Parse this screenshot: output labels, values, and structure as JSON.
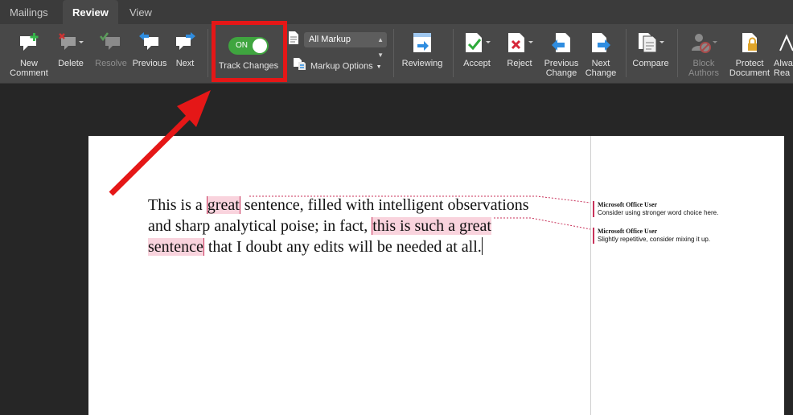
{
  "tabs": [
    {
      "label": "Mailings",
      "active": false
    },
    {
      "label": "Review",
      "active": true
    },
    {
      "label": "View",
      "active": false
    }
  ],
  "ribbon": {
    "new_comment": "New\nComment",
    "delete": "Delete",
    "resolve": "Resolve",
    "previous": "Previous",
    "next": "Next",
    "track_changes": {
      "label": "Track Changes",
      "state": "ON"
    },
    "display_for_review": "All Markup",
    "markup_options": "Markup Options",
    "reviewing": "Reviewing",
    "accept": "Accept",
    "reject": "Reject",
    "previous_change": "Previous\nChange",
    "next_change": "Next\nChange",
    "compare": "Compare",
    "block_authors": "Block\nAuthors",
    "protect_document": "Protect\nDocument",
    "always": "Alwa\nRea"
  },
  "document": {
    "seg1": "This is a ",
    "seg2": "great",
    "seg3": " sentence, filled with intelligent observations and sharp analytical poise; in fact, ",
    "seg4": "this is such a great sentence",
    "seg5": " that I doubt any edits will be needed at all."
  },
  "comments": [
    {
      "author": "Microsoft Office User",
      "text": "Consider using stronger word choice here."
    },
    {
      "author": "Microsoft Office User",
      "text": "Slightly repetitive, consider mixing it up."
    }
  ],
  "colors": {
    "toggle_on": "#3fa53f",
    "highlight_box": "#e51717",
    "arrow": "#e51717",
    "comment_marker": "#c8325a"
  }
}
